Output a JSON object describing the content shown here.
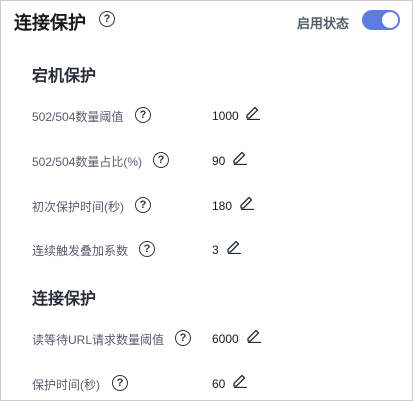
{
  "header": {
    "title": "连接保护",
    "switch_label": "启用状态",
    "switch_on": true,
    "accent_color": "#5e7ce0"
  },
  "sections": [
    {
      "title": "宕机保护",
      "rows": [
        {
          "label": "502/504数量阈值",
          "value": "1000"
        },
        {
          "label": "502/504数量占比(%)",
          "value": "90"
        },
        {
          "label": "初次保护时间(秒)",
          "value": "180"
        },
        {
          "label": "连续触发叠加系数",
          "value": "3"
        }
      ]
    },
    {
      "title": "连接保护",
      "rows": [
        {
          "label": "读等待URL请求数量阈值",
          "value": "6000"
        },
        {
          "label": "保护时间(秒)",
          "value": "60"
        }
      ]
    }
  ],
  "icons": {
    "help": "question-circle-icon",
    "edit": "pencil-icon"
  },
  "help_glyph": "?"
}
